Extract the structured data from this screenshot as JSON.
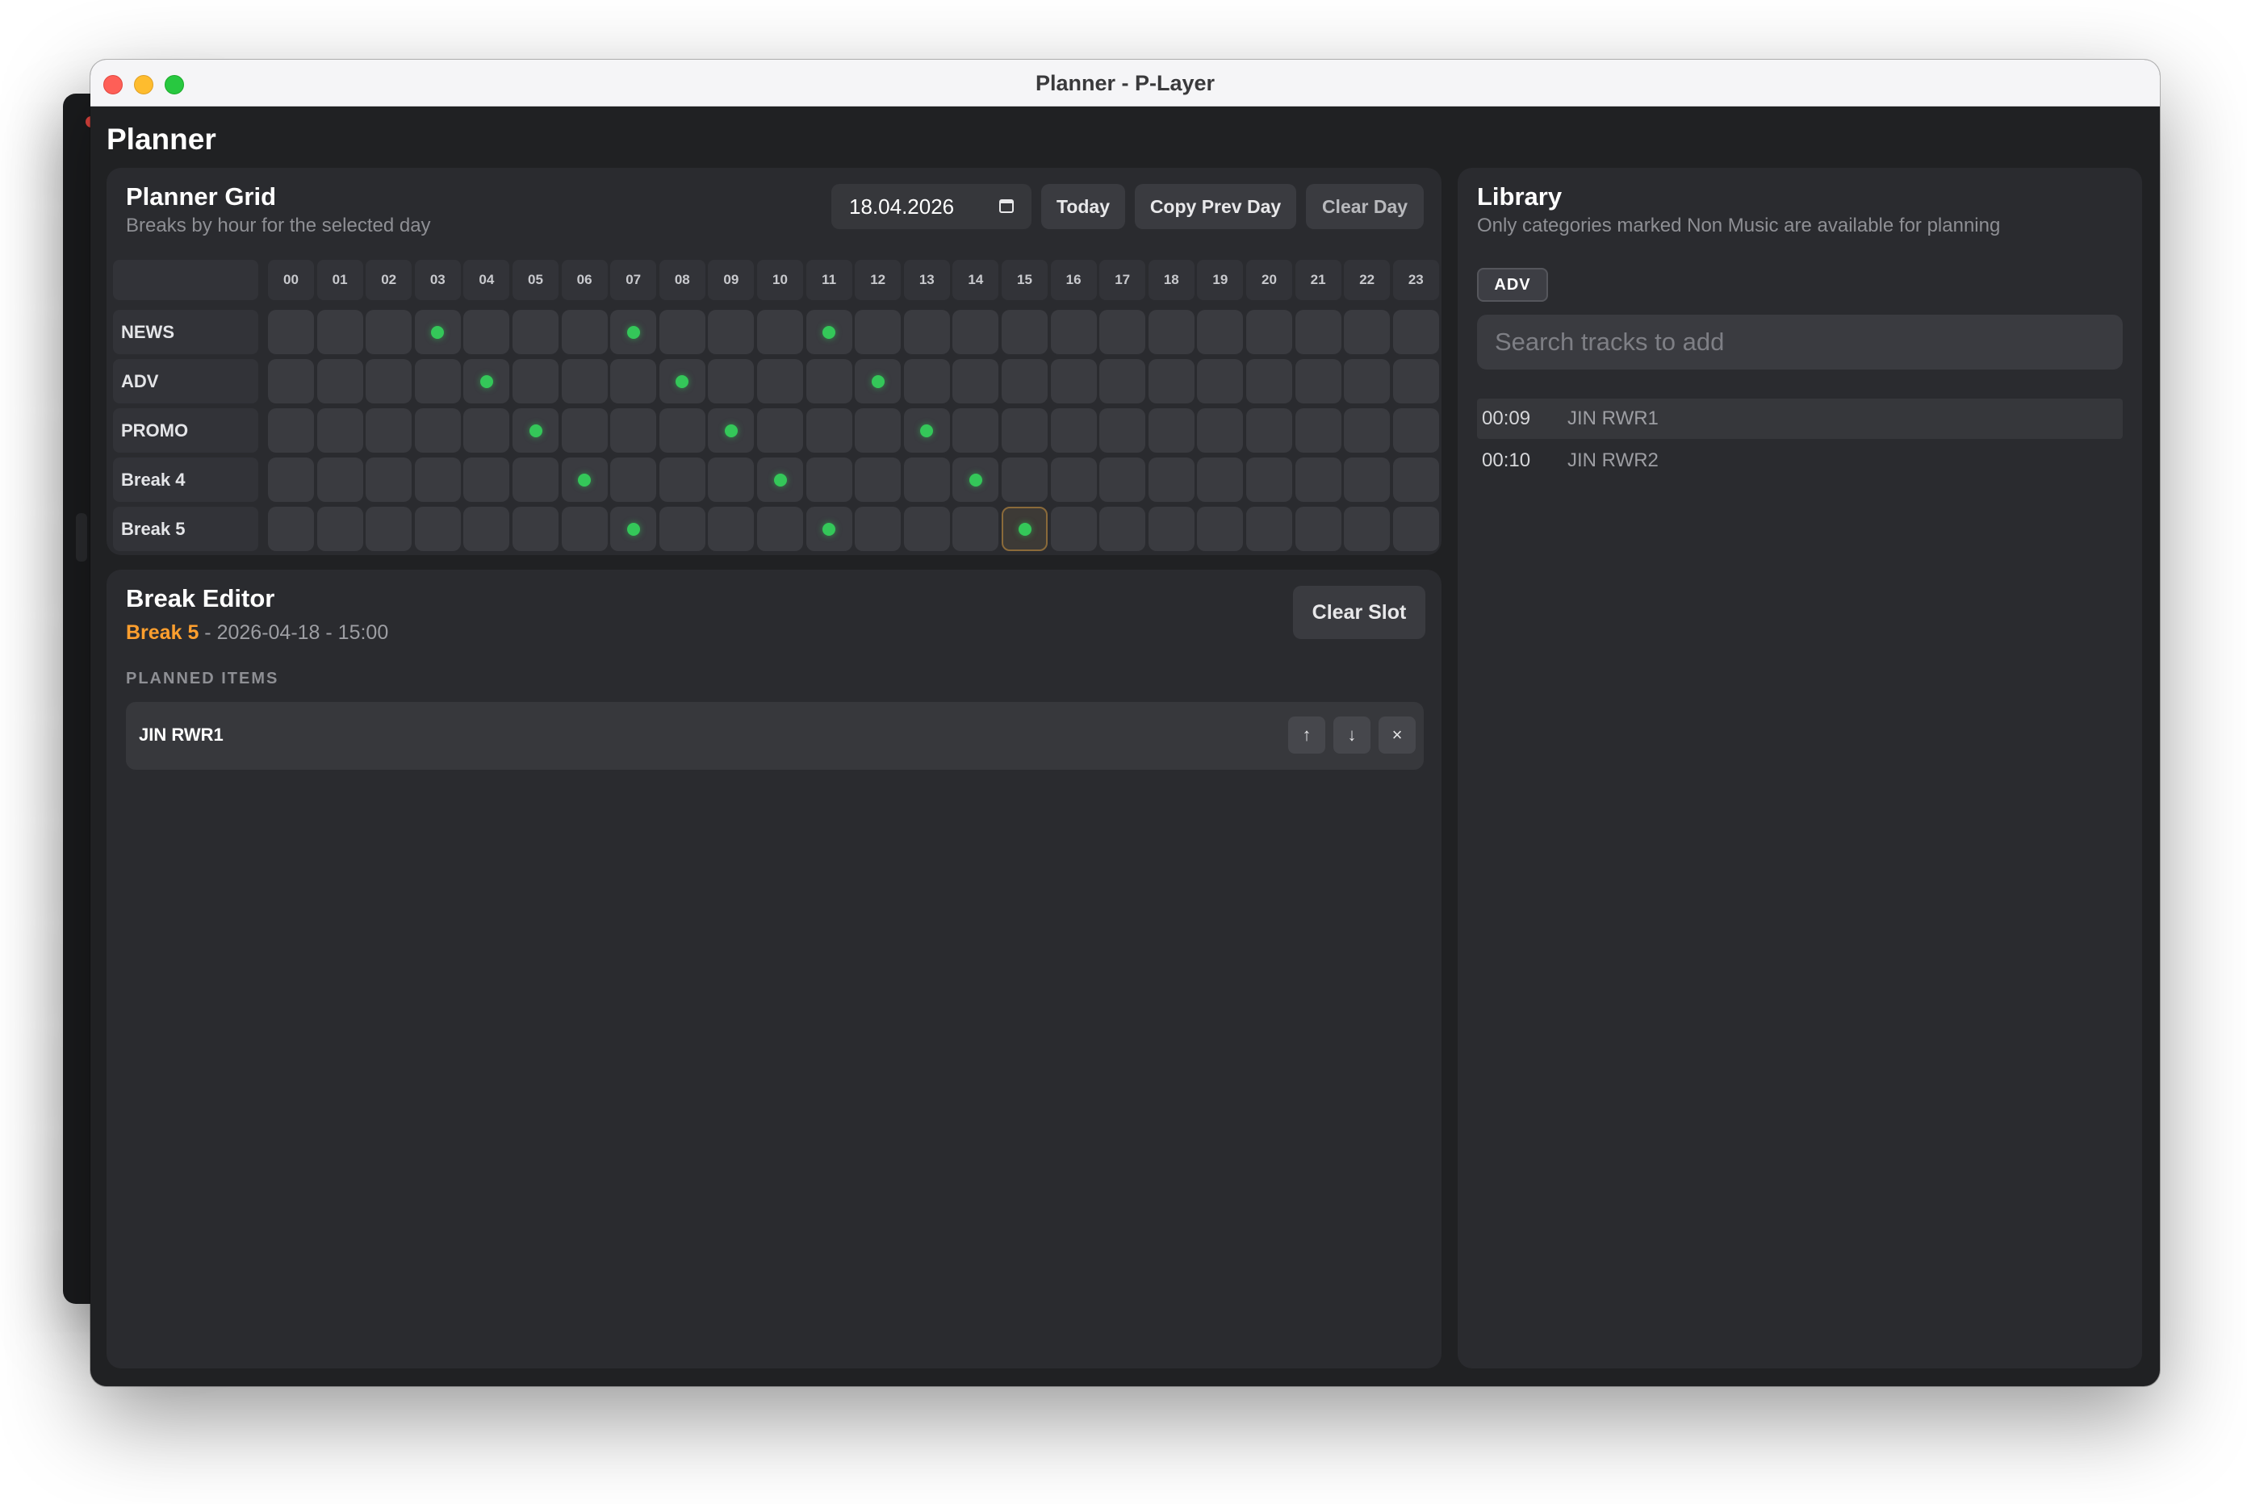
{
  "window": {
    "title": "Planner - P-Layer"
  },
  "page": {
    "title": "Planner"
  },
  "grid_panel": {
    "title": "Planner Grid",
    "subtitle": "Breaks by hour for the selected day",
    "date_value": "18.04.2026",
    "buttons": {
      "today": "Today",
      "copy_prev": "Copy Prev Day",
      "clear_day": "Clear Day"
    },
    "hours": [
      "00",
      "01",
      "02",
      "03",
      "04",
      "05",
      "06",
      "07",
      "08",
      "09",
      "10",
      "11",
      "12",
      "13",
      "14",
      "15",
      "16",
      "17",
      "18",
      "19",
      "20",
      "21",
      "22",
      "23"
    ],
    "rows": [
      {
        "label": "NEWS",
        "planned_hours": [
          3,
          7,
          11
        ]
      },
      {
        "label": "ADV",
        "planned_hours": [
          4,
          8,
          12
        ]
      },
      {
        "label": "PROMO",
        "planned_hours": [
          5,
          9,
          13
        ]
      },
      {
        "label": "Break 4",
        "planned_hours": [
          6,
          10,
          14
        ]
      },
      {
        "label": "Break 5",
        "planned_hours": [
          7,
          11,
          15
        ]
      }
    ],
    "selected": {
      "row": 4,
      "hour": 15
    }
  },
  "editor": {
    "title": "Break Editor",
    "break_name": "Break 5",
    "detail": " - 2026-04-18 - 15:00",
    "clear_slot": "Clear Slot",
    "section_label": "PLANNED ITEMS",
    "items": [
      {
        "name": "JIN RWR1"
      }
    ],
    "item_actions": {
      "up": "↑",
      "down": "↓",
      "remove": "×"
    }
  },
  "library": {
    "title": "Library",
    "subtitle": "Only categories marked Non Music are available for planning",
    "category_chip": "ADV",
    "search_placeholder": "Search tracks to add",
    "tracks": [
      {
        "duration": "00:09",
        "name": "JIN RWR1"
      },
      {
        "duration": "00:10",
        "name": "JIN RWR2"
      }
    ]
  },
  "colors": {
    "accent_orange": "#ff9f2e",
    "planned_dot": "#34c759",
    "panel_bg": "#2a2b2f",
    "window_bg": "#202123"
  }
}
